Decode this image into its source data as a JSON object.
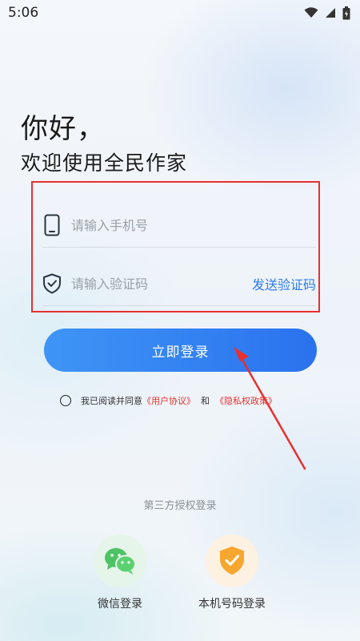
{
  "status_bar": {
    "time": "5:06"
  },
  "greeting": {
    "line1": "你好，",
    "line2": "欢迎使用全民作家"
  },
  "form": {
    "phone_placeholder": "请输入手机号",
    "code_placeholder": "请输入验证码",
    "send_code_label": "发送验证码"
  },
  "login_button_label": "立即登录",
  "agreement": {
    "prefix": "我已阅读并同意",
    "user_agreement": "《用户协议》",
    "and": "和",
    "privacy_policy": "《隐私权政策》"
  },
  "third_party": {
    "title": "第三方授权登录",
    "wechat_label": "微信登录",
    "phone_label": "本机号码登录"
  },
  "colors": {
    "accent": "#2f7cf0",
    "highlight_red": "#e8302f",
    "wechat_green": "#4cc364",
    "shield_orange": "#f7a72f"
  },
  "icons": [
    "wifi-icon",
    "signal-icon",
    "battery-icon",
    "phone-device-icon",
    "shield-check-icon",
    "wechat-icon",
    "verified-shield-icon"
  ]
}
